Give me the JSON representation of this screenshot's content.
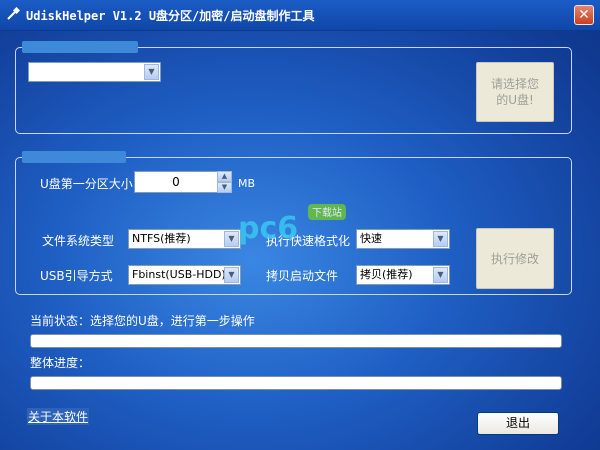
{
  "window": {
    "title": "UdiskHelper V1.2  U盘分区/加密/启动盘制作工具",
    "close_glyph": "✕"
  },
  "disk_group": {
    "legend": "",
    "disk_select_value": "",
    "select_disk_button": "请选择您的U盘!"
  },
  "settings_group": {
    "legend": "",
    "partition_size_label": "U盘第一分区大小",
    "partition_size_value": "0",
    "partition_size_unit": "MB",
    "filesystem_label": "文件系统类型",
    "filesystem_value": "NTFS(推荐)",
    "quick_format_label": "执行快速格式化",
    "quick_format_value": "快速",
    "usb_boot_label": "USB引导方式",
    "usb_boot_value": "Fbinst(USB-HDD)",
    "copy_boot_label": "拷贝启动文件",
    "copy_boot_value": "拷贝(推荐)",
    "execute_button": "执行修改"
  },
  "status": {
    "current_label": "当前状态：选择您的U盘，进行第一步操作",
    "current_progress": 0,
    "overall_label": "整体进度：",
    "overall_progress": 0
  },
  "footer": {
    "about_link": "关于本软件",
    "exit_button": "退出"
  },
  "watermark": {
    "text": "pc6",
    "badge": "下载站"
  },
  "colors": {
    "background": "#1f5fc4",
    "titlebar": "#1b5cc6",
    "close": "#c8401f"
  }
}
